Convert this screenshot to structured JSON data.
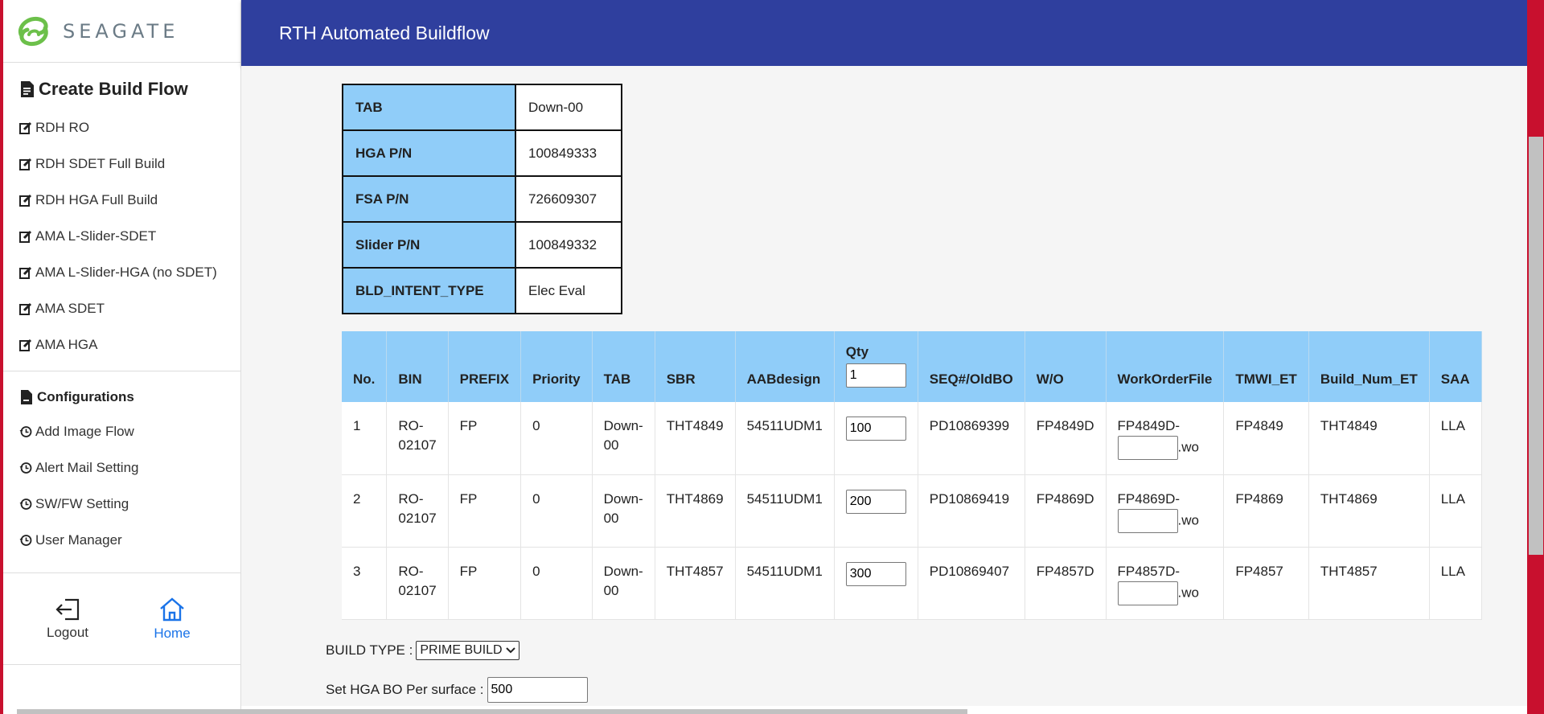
{
  "brand": {
    "logo_text": "SEAGATE"
  },
  "header": {
    "title": "RTH Automated Buildflow"
  },
  "sidebar": {
    "create_title": "Create Build Flow",
    "create_items": [
      {
        "label": "RDH RO"
      },
      {
        "label": "RDH SDET Full Build"
      },
      {
        "label": "RDH HGA Full Build"
      },
      {
        "label": "AMA L-Slider-SDET"
      },
      {
        "label": "AMA L-Slider-HGA (no SDET)"
      },
      {
        "label": "AMA SDET"
      },
      {
        "label": "AMA HGA"
      }
    ],
    "config_title": "Configurations",
    "config_items": [
      {
        "label": "Add Image Flow"
      },
      {
        "label": "Alert Mail Setting"
      },
      {
        "label": "SW/FW Setting"
      },
      {
        "label": "User Manager"
      }
    ],
    "logout_label": "Logout",
    "home_label": "Home"
  },
  "info": {
    "rows": [
      {
        "key": "TAB",
        "value": "Down-00"
      },
      {
        "key": "HGA P/N",
        "value": "100849333"
      },
      {
        "key": "FSA P/N",
        "value": "726609307"
      },
      {
        "key": "Slider P/N",
        "value": "100849332"
      },
      {
        "key": "BLD_INTENT_TYPE",
        "value": "Elec Eval"
      }
    ]
  },
  "table": {
    "headers": [
      "No.",
      "BIN",
      "PREFIX",
      "Priority",
      "TAB",
      "SBR",
      "AABdesign",
      "Qty",
      "SEQ#/OldBO",
      "W/O",
      "WorkOrderFile",
      "TMWI_ET",
      "Build_Num_ET",
      "SAA"
    ],
    "qty_default": "1",
    "rows": [
      {
        "no": "1",
        "bin": "RO-02107",
        "prefix": "FP",
        "priority": "0",
        "tab": "Down-00",
        "sbr": "THT4849",
        "aab": "54511UDM1",
        "qty": "100",
        "seq": "PD10869399",
        "wo": "FP4849D",
        "wof_prefix": "FP4849D-",
        "wof_suffix": ".wo",
        "tmwi": "FP4849",
        "build": "THT4849",
        "saa": "LLA"
      },
      {
        "no": "2",
        "bin": "RO-02107",
        "prefix": "FP",
        "priority": "0",
        "tab": "Down-00",
        "sbr": "THT4869",
        "aab": "54511UDM1",
        "qty": "200",
        "seq": "PD10869419",
        "wo": "FP4869D",
        "wof_prefix": "FP4869D-",
        "wof_suffix": ".wo",
        "tmwi": "FP4869",
        "build": "THT4869",
        "saa": "LLA"
      },
      {
        "no": "3",
        "bin": "RO-02107",
        "prefix": "FP",
        "priority": "0",
        "tab": "Down-00",
        "sbr": "THT4857",
        "aab": "54511UDM1",
        "qty": "300",
        "seq": "PD10869407",
        "wo": "FP4857D",
        "wof_prefix": "FP4857D-",
        "wof_suffix": ".wo",
        "tmwi": "FP4857",
        "build": "THT4857",
        "saa": "LLA"
      }
    ]
  },
  "build_type": {
    "label": "BUILD TYPE :",
    "selected": "PRIME BUILD"
  },
  "hga_bo": {
    "label": "Set HGA BO Per surface :",
    "value": "500"
  },
  "colors": {
    "header_bg": "#2f3f9e",
    "table_head_bg": "#90cdf9",
    "accent_red": "#c8102e",
    "home_blue": "#1a73e8"
  }
}
